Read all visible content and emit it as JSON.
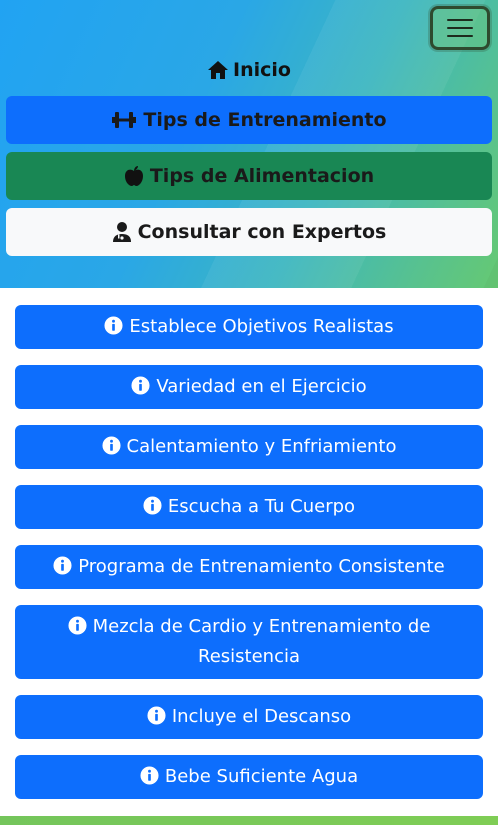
{
  "nav": {
    "home_label": "Inicio",
    "training_label": "Tips de Entrenamiento",
    "food_label": "Tips de Alimentacion",
    "experts_label": "Consultar con Expertos"
  },
  "tips": [
    {
      "label": "Establece Objetivos Realistas"
    },
    {
      "label": "Variedad en el Ejercicio"
    },
    {
      "label": "Calentamiento y Enfriamiento"
    },
    {
      "label": "Escucha a Tu Cuerpo"
    },
    {
      "label": "Programa de Entrenamiento Consistente"
    },
    {
      "label": "Mezcla de Cardio y Entrenamiento de Resistencia"
    },
    {
      "label": "Incluye el Descanso"
    },
    {
      "label": "Bebe Suficiente Agua"
    }
  ],
  "colors": {
    "primary": "#0d6efd",
    "success": "#198754",
    "light": "#f8f9fa"
  },
  "icons": {
    "home": "house-icon",
    "training": "dumbbell-icon",
    "food": "apple-icon",
    "experts": "doctor-icon",
    "tip": "info-circle-icon",
    "menu": "hamburger-icon"
  }
}
